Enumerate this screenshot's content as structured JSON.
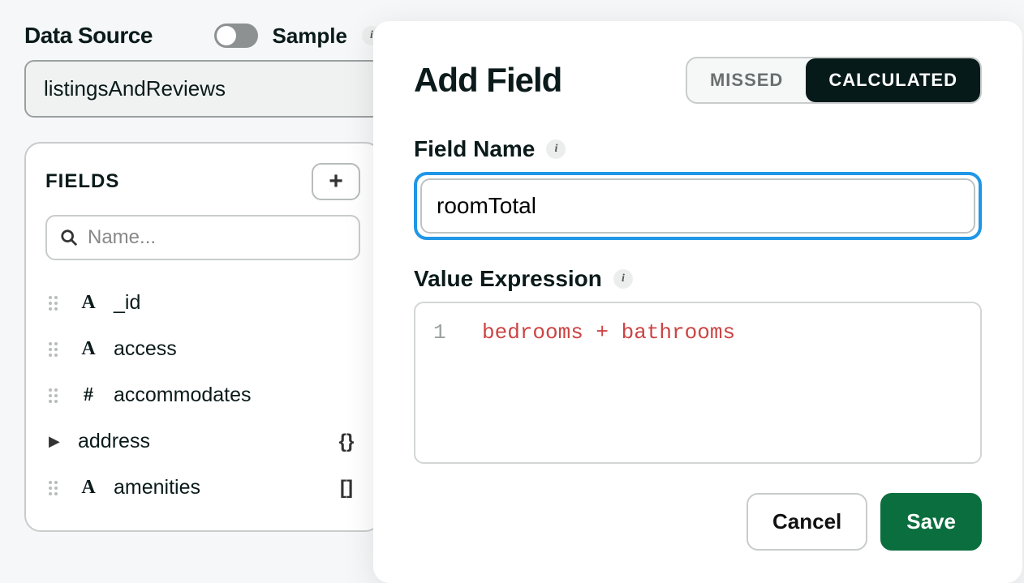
{
  "header": {
    "data_source_label": "Data Source",
    "sample_label": "Sample",
    "data_source_value": "listingsAndReviews"
  },
  "sidebar": {
    "fields_title": "FIELDS",
    "search_placeholder": "Name...",
    "items": [
      {
        "name": "_id",
        "type_icon": "A",
        "right_icon": ""
      },
      {
        "name": "access",
        "type_icon": "A",
        "right_icon": ""
      },
      {
        "name": "accommodates",
        "type_icon": "#",
        "right_icon": ""
      },
      {
        "name": "address",
        "type_icon": "",
        "right_icon": "{}",
        "expandable": true
      },
      {
        "name": "amenities",
        "type_icon": "A",
        "right_icon": "[]"
      }
    ]
  },
  "modal": {
    "title": "Add Field",
    "tabs": {
      "missed": "MISSED",
      "calculated": "CALCULATED",
      "active": "calculated"
    },
    "field_name_label": "Field Name",
    "field_name_value": "roomTotal",
    "value_expression_label": "Value Expression",
    "value_expression_code": "bedrooms + bathrooms",
    "code_line_number": "1",
    "cancel_label": "Cancel",
    "save_label": "Save"
  }
}
